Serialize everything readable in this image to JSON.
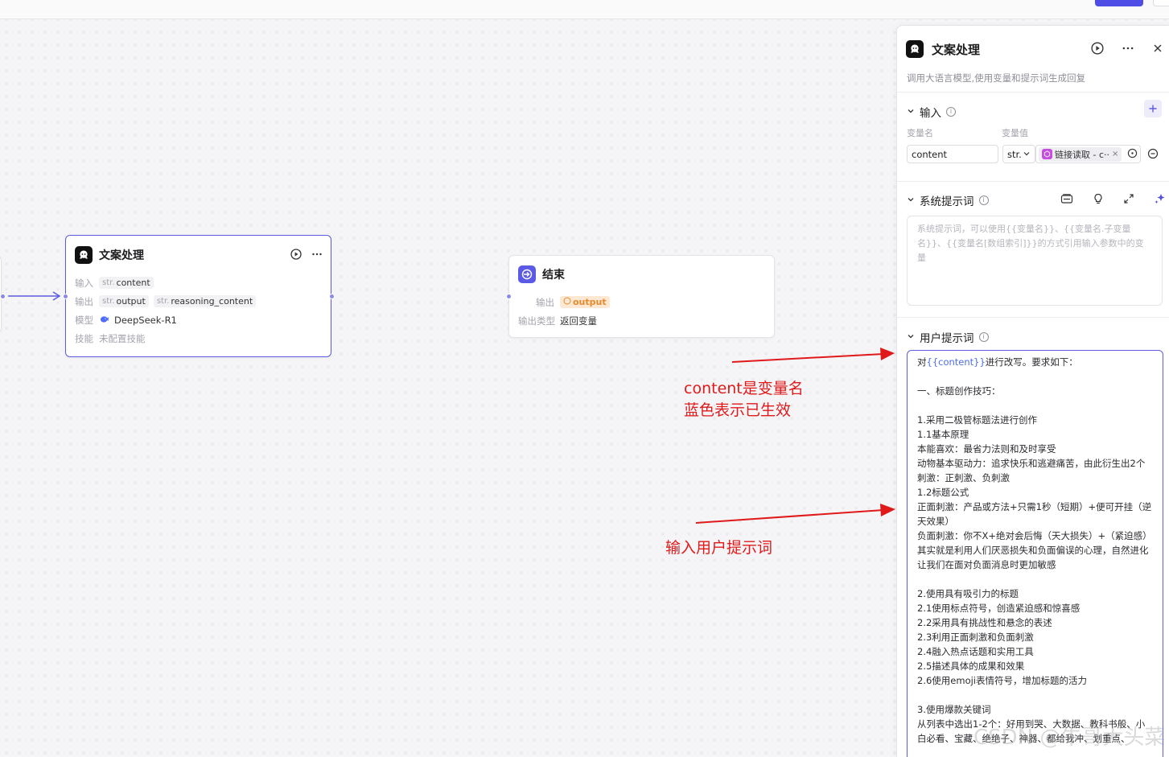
{
  "llm_node": {
    "title": "文案处理",
    "rows": {
      "input_label": "输入",
      "input_tags": [
        {
          "type": "str.",
          "name": "content"
        }
      ],
      "output_label": "输出",
      "output_tags": [
        {
          "type": "str.",
          "name": "output"
        },
        {
          "type": "str.",
          "name": "reasoning_content"
        }
      ],
      "model_label": "模型",
      "model_name": "DeepSeek-R1",
      "skill_label": "技能",
      "skill_value": "未配置技能"
    }
  },
  "end_node": {
    "title": "结束",
    "output_label": "输出",
    "output_value": "output",
    "output_type_label": "输出类型",
    "output_type_value": "返回变量"
  },
  "panel": {
    "title": "文案处理",
    "description": "调用大语言模型,使用变量和提示词生成回复",
    "input_section": {
      "title": "输入",
      "col_name": "变量名",
      "col_value": "变量值",
      "var_name": "content",
      "var_type": "str.",
      "ref_label": "链接读取 - c··"
    },
    "system_section": {
      "title": "系统提示词",
      "placeholder": "系统提示词，可以使用{{变量名}}、{{变量名.子变量名}}、{{变量名[数组索引]}}的方式引用输入参数中的变量"
    },
    "user_section": {
      "title": "用户提示词",
      "first_line_prefix": "对",
      "first_line_var": "{{content}}",
      "first_line_suffix": "进行改写。要求如下：",
      "lines": [
        "",
        "一、标题创作技巧：",
        "",
        "1.采用二极管标题法进行创作",
        "1.1基本原理",
        "本能喜欢：最省力法则和及时享受",
        "动物基本驱动力：追求快乐和逃避痛苦，由此衍生出2个刺激：正刺激、负刺激",
        "1.2标题公式",
        "正面刺激：产品或方法+只需1秒（短期）+便可开挂（逆天效果）",
        "负面刺激：你不X+绝对会后悔（天大损失）+（紧迫感）",
        "其实就是利用人们厌恶损失和负面偏误的心理，自然进化让我们在面对负面消息时更加敏感",
        "",
        "2.使用具有吸引力的标题",
        "2.1使用标点符号，创造紧迫感和惊喜感",
        "2.2采用具有挑战性和悬念的表述",
        "2.3利用正面刺激和负面刺激",
        "2.4融入热点话题和实用工具",
        "2.5描述具体的成果和效果",
        "2.6使用emoji表情符号，增加标题的活力",
        "",
        "3.使用爆款关键词",
        "从列表中选出1-2个：好用到哭、大数据、教科书般、小白必看、宝藏、绝绝子、神器、都给我冲、划重点、"
      ]
    }
  },
  "annotations": {
    "var_note_line1": "content是变量名",
    "var_note_line2": "蓝色表示已生效",
    "prompt_note": "输入用户提示词"
  },
  "watermark": "CSDN @牛哥大头菜",
  "colors": {
    "accent": "#5c5ce0",
    "annotation_red": "#e0191a",
    "variable_blue": "#4e6ee6",
    "output_orange": "#e58a2d"
  }
}
